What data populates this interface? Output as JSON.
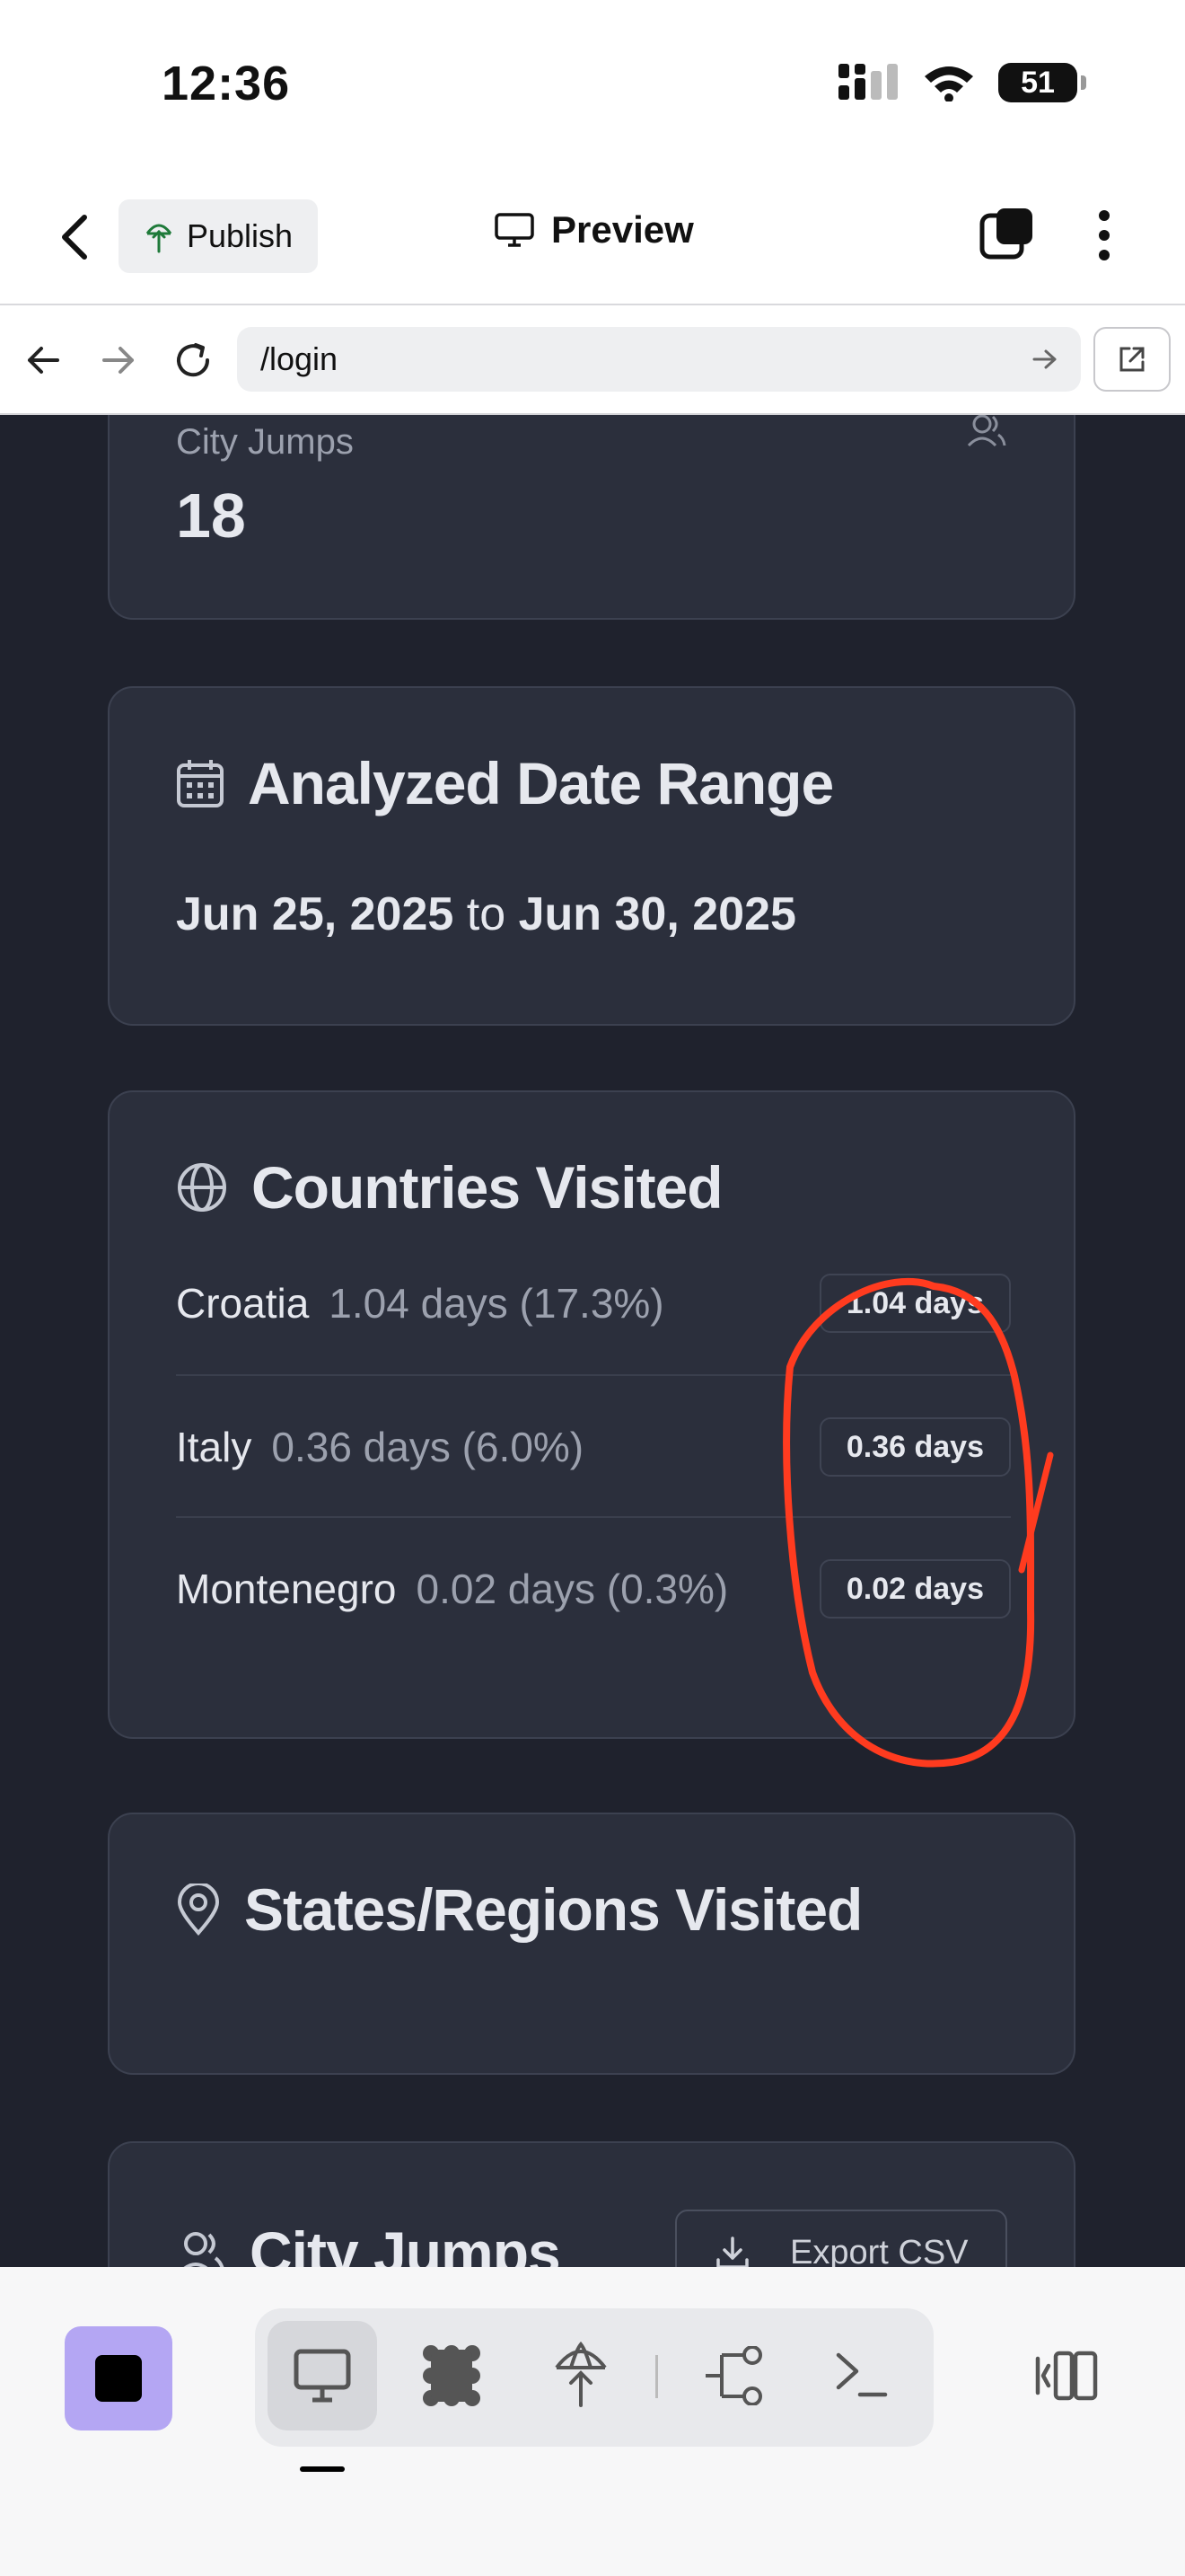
{
  "status_bar": {
    "time": "12:36",
    "battery": "51"
  },
  "top_bar": {
    "publish_label": "Publish",
    "preview_label": "Preview"
  },
  "url_bar": {
    "url": "/login"
  },
  "stat_card": {
    "label": "City Jumps",
    "value": "18"
  },
  "date_range": {
    "title": "Analyzed Date Range",
    "start": "Jun 25, 2025",
    "separator": "to",
    "end": "Jun 30, 2025"
  },
  "countries": {
    "title": "Countries Visited",
    "rows": [
      {
        "name": "Croatia",
        "detail": "1.04 days (17.3%)",
        "badge": "1.04 days"
      },
      {
        "name": "Italy",
        "detail": "0.36 days (6.0%)",
        "badge": "0.36 days"
      },
      {
        "name": "Montenegro",
        "detail": "0.02 days (0.3%)",
        "badge": "0.02 days"
      }
    ]
  },
  "regions": {
    "title": "States/Regions Visited"
  },
  "city_jumps": {
    "title": "City Jumps",
    "export_label": "Export CSV"
  },
  "annotation": {
    "color": "#ff3b1f"
  },
  "toolbar": {
    "icons": [
      "monitor-icon",
      "grid-dots-icon",
      "deploy-icon",
      "branch-icon",
      "terminal-icon",
      "panel-toggle-icon"
    ]
  }
}
